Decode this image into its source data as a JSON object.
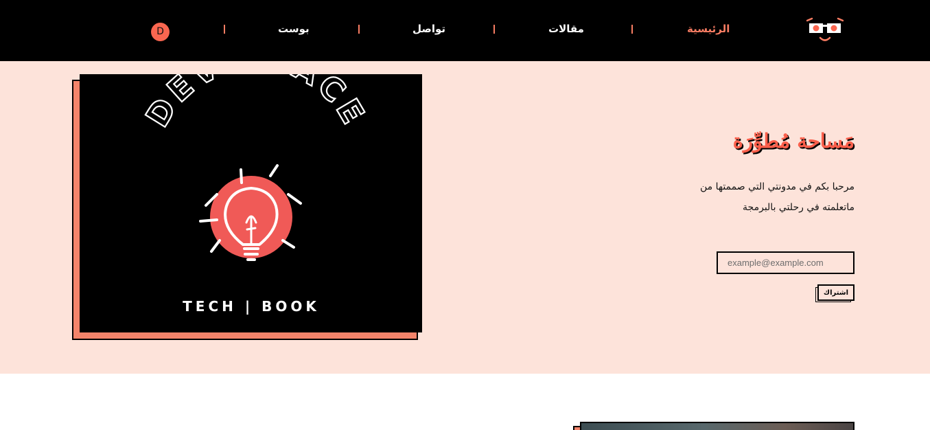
{
  "navbar": {
    "logo_icon": "smiley-glasses-icon",
    "links": [
      {
        "label": "الرئيسية",
        "active": true
      },
      {
        "label": "مقالات",
        "active": false
      },
      {
        "label": "تواصل",
        "active": false
      },
      {
        "label": "بوست",
        "active": false
      }
    ],
    "avatar_letter": "D"
  },
  "hero": {
    "image": {
      "arc_text": "DEV SPACE",
      "bottom_text": "TECH | BOOK",
      "icon": "lightbulb-icon"
    },
    "title": "مَساحة مُطوِّرَة",
    "description": "مرحبا بكم في مدونتي التي صممتها من ماتعلمته في رحلتي بالبرمجة",
    "email_placeholder": "example@example.com",
    "subscribe_label": "اشتراك"
  },
  "colors": {
    "accent": "#fa7d63",
    "hero_bg": "#fde3da",
    "nav_bg": "#000000",
    "title": "#fa5f4b"
  }
}
